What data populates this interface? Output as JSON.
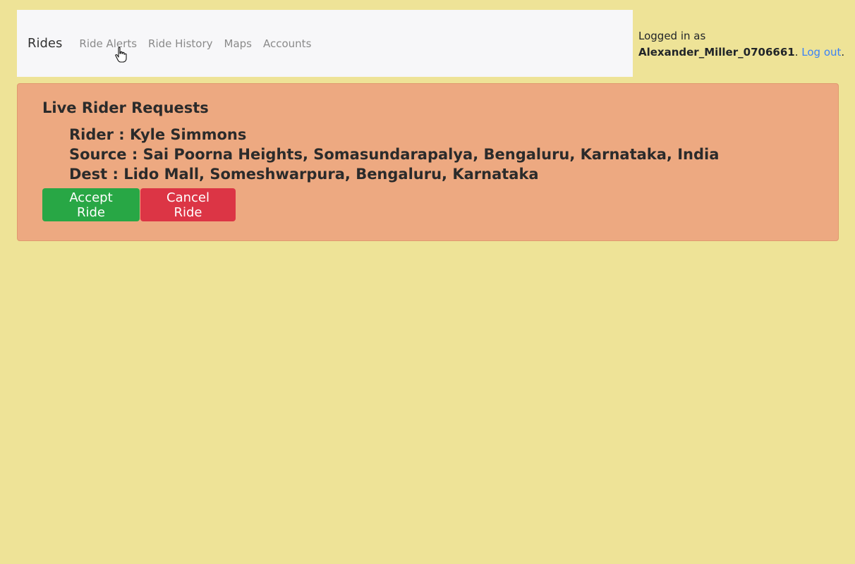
{
  "navbar": {
    "brand": "Rides",
    "links": [
      "Ride Alerts",
      "Ride History",
      "Maps",
      "Accounts"
    ]
  },
  "login": {
    "prefix": "Logged in as",
    "username": "Alexander_Miller_0706661",
    "separator": ".",
    "logout_label": "Log out",
    "suffix": "."
  },
  "alert": {
    "heading": "Live Rider Requests",
    "rider": "Rider : Kyle Simmons",
    "source": "Source : Sai Poorna Heights, Somasundarapalya, Bengaluru, Karnataka, India",
    "dest": "Dest : Lido Mall, Someshwarpura, Bengaluru, Karnataka",
    "accept_label": "Accept Ride",
    "cancel_label": "Cancel Ride"
  },
  "colors": {
    "page_background": "#eee397",
    "alert_background": "#eda981",
    "accept": "#28a745",
    "cancel": "#dc3545",
    "link": "#3b82f6"
  }
}
